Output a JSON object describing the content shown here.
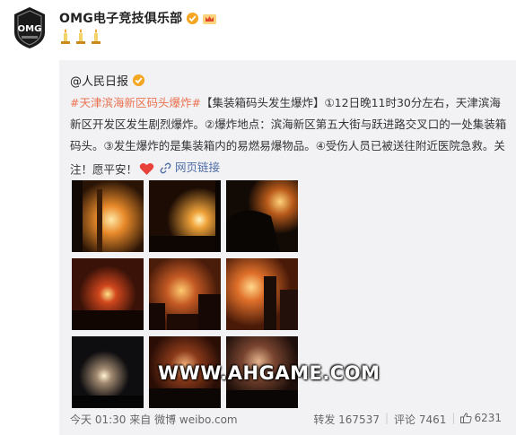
{
  "post": {
    "author": "OMG电子竞技俱乐部",
    "avatar_icon": "omg-logo",
    "verified_icon": "verified-badge-icon",
    "member_icon": "member-crown-icon",
    "emoji_icons": [
      "candle-icon",
      "candle-icon",
      "candle-icon"
    ]
  },
  "repost": {
    "author": "@人民日报",
    "tag_1": "#天津滨海新区码头爆炸#",
    "body_1": "【集装箱码头发生爆炸】①12日晚11时30分左右，天津滨海新区开发区发生剧烈爆炸。②爆炸地点：滨海新区第五大街与跃进路交叉口的一处集装箱码头。③发生爆炸的是集装箱内的易燃易爆物品。④受伤人员已被送往附近医院急救。关注！愿平安！",
    "weblink_label": "网页链接",
    "watermark": "WWW.AHGAME.COM",
    "time": "今天 01:30",
    "source_prefix": "来自",
    "source": "微博 weibo.com",
    "repost_label": "转发",
    "repost_count": "167537",
    "comment_label": "评论",
    "comment_count": "7461",
    "like_count": "6231"
  },
  "colors": {
    "tag": "#eb7350",
    "link": "#4f6ea5",
    "repost_bg": "#f2f2f5",
    "verified": "#f5a623"
  }
}
